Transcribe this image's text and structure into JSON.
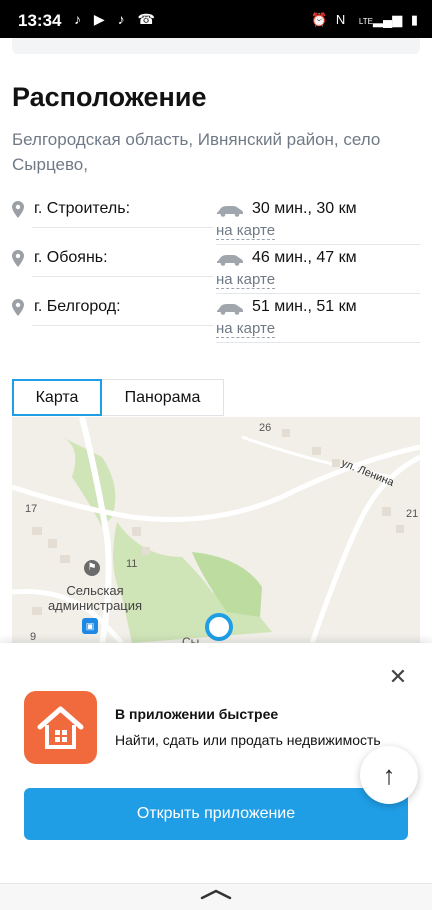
{
  "status_bar": {
    "time": "13:34",
    "left_icons": [
      "tiktok-icon",
      "youtube-icon",
      "tiktok-icon",
      "call-icon"
    ],
    "right_icons": [
      "alarm-icon",
      "nfc-icon",
      "lte-signal-icon",
      "battery-icon"
    ],
    "network": "LTE"
  },
  "location": {
    "title": "Расположение",
    "address": "Белгородская область, Ивнянский район, село Сырцево,",
    "routes": [
      {
        "city": "г. Строитель:",
        "duration": "30 мин., 30 км",
        "map_link": "на карте"
      },
      {
        "city": "г. Обоянь:",
        "duration": "46 мин., 47 км",
        "map_link": "на карте"
      },
      {
        "city": "г. Белгород:",
        "duration": "51 мин., 51 км",
        "map_link": "на карте"
      }
    ]
  },
  "map_tabs": {
    "map": "Карта",
    "panorama": "Панорама",
    "active": "Карта"
  },
  "map": {
    "street": "ул. Ленина",
    "place": "Сельская администрация",
    "house_numbers": [
      "26",
      "17",
      "11",
      "21",
      "9"
    ],
    "marker_label_fragment": "Сы"
  },
  "app_banner": {
    "title": "В приложении быстрее",
    "subtitle": "Найти, сдать или продать недвижимость",
    "button": "Открыть приложение",
    "icon": "house-icon"
  },
  "colors": {
    "accent": "#1f9ee6",
    "app_icon": "#f06a3d",
    "muted_text": "#707a86"
  }
}
